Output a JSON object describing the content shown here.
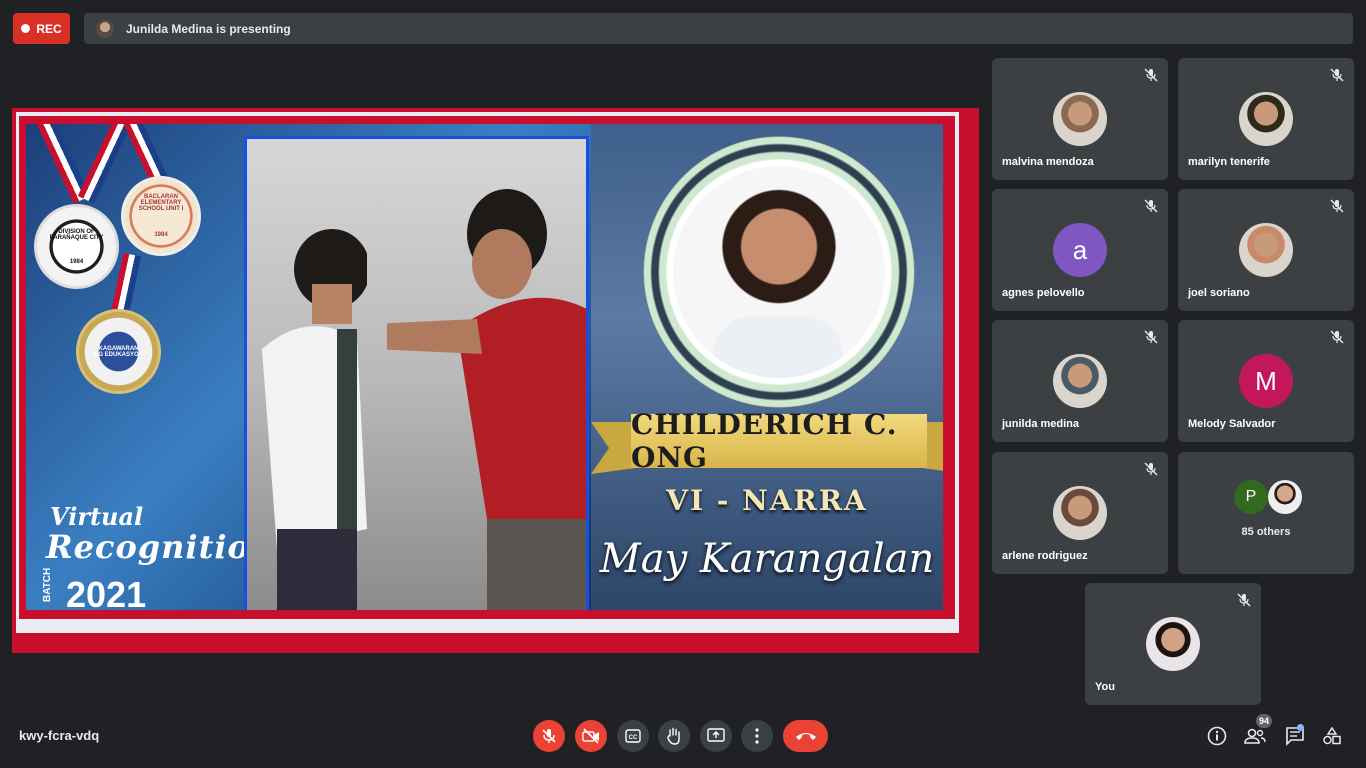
{
  "recording": {
    "label": "REC"
  },
  "presenter_bar": {
    "text": "Junilda Medina is presenting"
  },
  "slide": {
    "school_medal": "BACLARAN ELEMENTARY SCHOOL UNIT I",
    "division_medal": "DIVISION OF PARAÑAQUE CITY",
    "division_year": "1984",
    "school_year": "1984",
    "deped_medal": "KAGAWARAN NG EDUKASYON",
    "virtual": "Virtual",
    "recognition": "Recognition",
    "batch": "BATCH",
    "year": "2021",
    "student_name": "CHILDERICH C. ONG",
    "section": "VI - NARRA",
    "honor": "May Karangalan"
  },
  "participants": [
    {
      "name": "malvina mendoza",
      "avatar_type": "photo",
      "color": "#8a6a4f"
    },
    {
      "name": "marilyn tenerife",
      "avatar_type": "photo",
      "color": "#2d2a1b"
    },
    {
      "name": "agnes pelovello",
      "avatar_type": "letter",
      "letter": "a",
      "color": "#7e57c2"
    },
    {
      "name": "joel soriano",
      "avatar_type": "photo",
      "color": "#c98a6a"
    },
    {
      "name": "junilda medina",
      "avatar_type": "photo",
      "color": "#4a5a66"
    },
    {
      "name": "Melody Salvador",
      "avatar_type": "letter",
      "letter": "M",
      "color": "#c2185b"
    },
    {
      "name": "arlene rodriguez",
      "avatar_type": "photo",
      "color": "#6a4a3a"
    }
  ],
  "others": {
    "letter": "P",
    "letter_color": "#33691e",
    "label": "85 others"
  },
  "self_tile": {
    "name": "You"
  },
  "meeting": {
    "code": "kwy-fcra-vdq"
  },
  "controls": {
    "mic": "mic-off-icon",
    "camera": "camera-off-icon",
    "captions": "captions-icon",
    "raise_hand": "hand-icon",
    "present": "present-icon",
    "more": "more-icon",
    "leave": "leave-call-icon"
  },
  "side_controls": {
    "people_count": "94"
  }
}
